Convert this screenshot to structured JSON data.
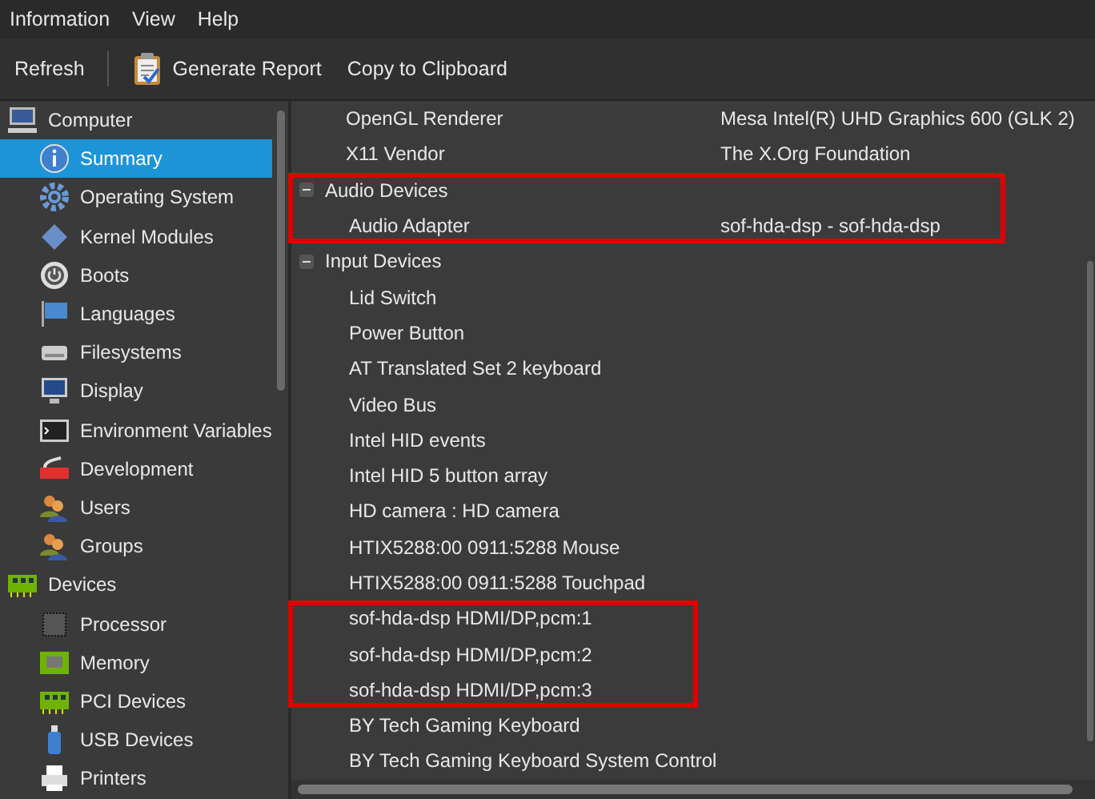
{
  "menu": [
    "Information",
    "View",
    "Help"
  ],
  "toolbar": {
    "refresh": "Refresh",
    "generate_report": "Generate Report",
    "copy": "Copy to Clipboard"
  },
  "sidebar": [
    {
      "label": "Computer",
      "children": [
        {
          "label": "Summary",
          "selected": true
        },
        {
          "label": "Operating System",
          "selected": false
        },
        {
          "label": "Kernel Modules",
          "selected": false
        },
        {
          "label": "Boots",
          "selected": false
        },
        {
          "label": "Languages",
          "selected": false
        },
        {
          "label": "Filesystems",
          "selected": false
        },
        {
          "label": "Display",
          "selected": false
        },
        {
          "label": "Environment Variables",
          "selected": false
        },
        {
          "label": "Development",
          "selected": false
        },
        {
          "label": "Users",
          "selected": false
        },
        {
          "label": "Groups",
          "selected": false
        }
      ]
    },
    {
      "label": "Devices",
      "children": [
        {
          "label": "Processor",
          "selected": false
        },
        {
          "label": "Memory",
          "selected": false
        },
        {
          "label": "PCI Devices",
          "selected": false
        },
        {
          "label": "USB Devices",
          "selected": false
        },
        {
          "label": "Printers",
          "selected": false
        }
      ]
    }
  ],
  "details": [
    {
      "kind": "item",
      "label": "OpenGL Renderer",
      "value": "Mesa Intel(R) UHD Graphics 600 (GLK 2)",
      "outlined": false
    },
    {
      "kind": "item",
      "label": "X11 Vendor",
      "value": "The X.Org Foundation",
      "outlined": false
    },
    {
      "kind": "group",
      "label": "Audio Devices",
      "expanded": true,
      "outlined": true,
      "children": [
        {
          "kind": "item",
          "label": "Audio Adapter",
          "value": "sof-hda-dsp - sof-hda-dsp",
          "outlined": true
        }
      ]
    },
    {
      "kind": "group",
      "label": "Input Devices",
      "expanded": true,
      "outlined": false,
      "children": [
        {
          "kind": "item",
          "label": "Lid Switch",
          "outlined": false
        },
        {
          "kind": "item",
          "label": "Power Button",
          "outlined": false
        },
        {
          "kind": "item",
          "label": "AT Translated Set 2 keyboard",
          "outlined": false
        },
        {
          "kind": "item",
          "label": "Video Bus",
          "outlined": false
        },
        {
          "kind": "item",
          "label": "Intel HID events",
          "outlined": false
        },
        {
          "kind": "item",
          "label": "Intel HID 5 button array",
          "outlined": false
        },
        {
          "kind": "item",
          "label": "HD camera : HD camera",
          "outlined": false
        },
        {
          "kind": "item",
          "label": "HTIX5288:00 0911:5288 Mouse",
          "outlined": false
        },
        {
          "kind": "item",
          "label": "HTIX5288:00 0911:5288 Touchpad",
          "outlined": false
        },
        {
          "kind": "item",
          "label": "sof-hda-dsp HDMI/DP,pcm:1",
          "outlined": true
        },
        {
          "kind": "item",
          "label": "sof-hda-dsp HDMI/DP,pcm:2",
          "outlined": true
        },
        {
          "kind": "item",
          "label": "sof-hda-dsp HDMI/DP,pcm:3",
          "outlined": true
        },
        {
          "kind": "item",
          "label": "BY Tech Gaming Keyboard",
          "outlined": false
        },
        {
          "kind": "item",
          "label": "BY Tech Gaming Keyboard System Control",
          "outlined": false
        }
      ]
    }
  ]
}
